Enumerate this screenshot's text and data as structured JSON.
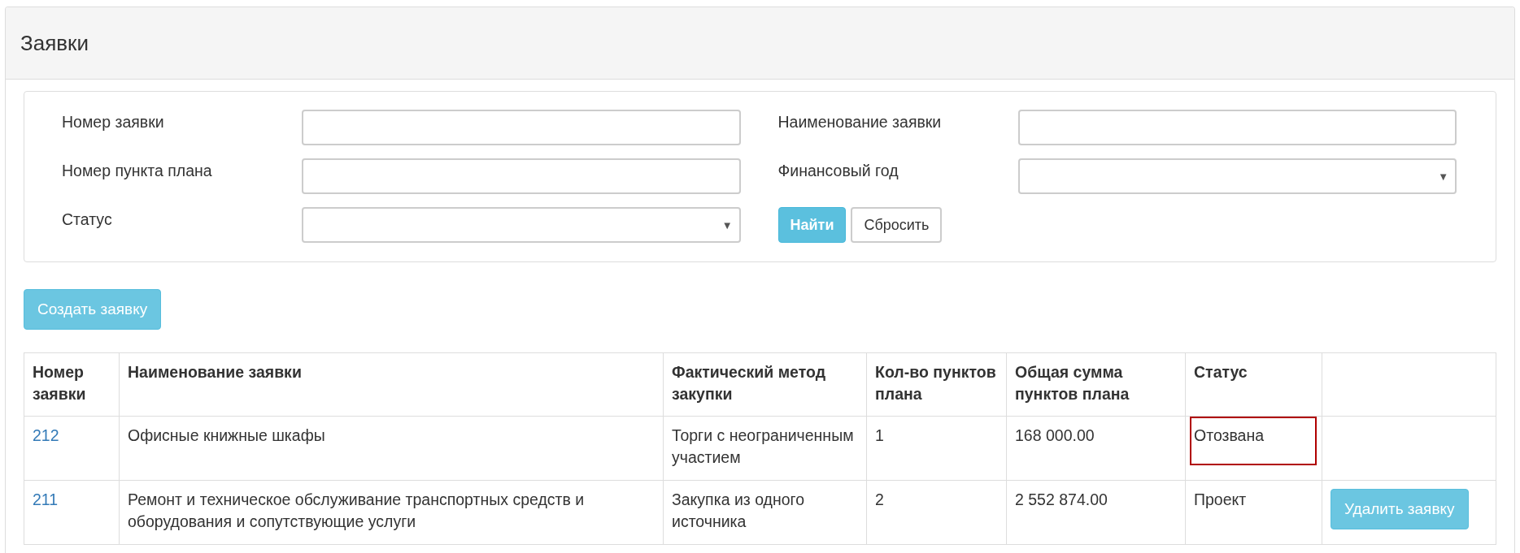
{
  "panel": {
    "title": "Заявки"
  },
  "filters": {
    "left": [
      {
        "kind": "text",
        "label": "Номер заявки"
      },
      {
        "kind": "text",
        "label": "Номер пункта плана"
      },
      {
        "kind": "select",
        "label": "Статус",
        "arrow": "▼"
      }
    ],
    "right": [
      {
        "kind": "text",
        "label": "Наименование заявки"
      },
      {
        "kind": "select",
        "label": "Финансовый год",
        "arrow": "▼"
      }
    ],
    "buttons": [
      {
        "kind": "primary",
        "label": "Найти"
      },
      {
        "kind": "default",
        "label": "Сбросить"
      }
    ]
  },
  "create_button": "Создать заявку",
  "table": {
    "columns": [
      "Номер заявки",
      "Наименование заявки",
      "Фактический метод закупки",
      "Кол-во пунктов плана",
      "Общая сумма пунктов плана",
      "Статус"
    ],
    "rows": [
      {
        "number": "212",
        "name": "Офисные книжные шкафы",
        "method": "Торги с неограниченным участием",
        "count": "1",
        "sum": "168 000.00",
        "status": "Отозвана",
        "status_highlighted": true
      },
      {
        "number": "211",
        "name": "Ремонт и техническое обслуживание транспортных средств и оборудования и сопутствующие услуги",
        "method": "Закупка из одного источника",
        "count": "2",
        "sum": "2 552 874.00",
        "status": "Проект",
        "status_highlighted": false,
        "action": "Удалить заявку"
      }
    ]
  }
}
